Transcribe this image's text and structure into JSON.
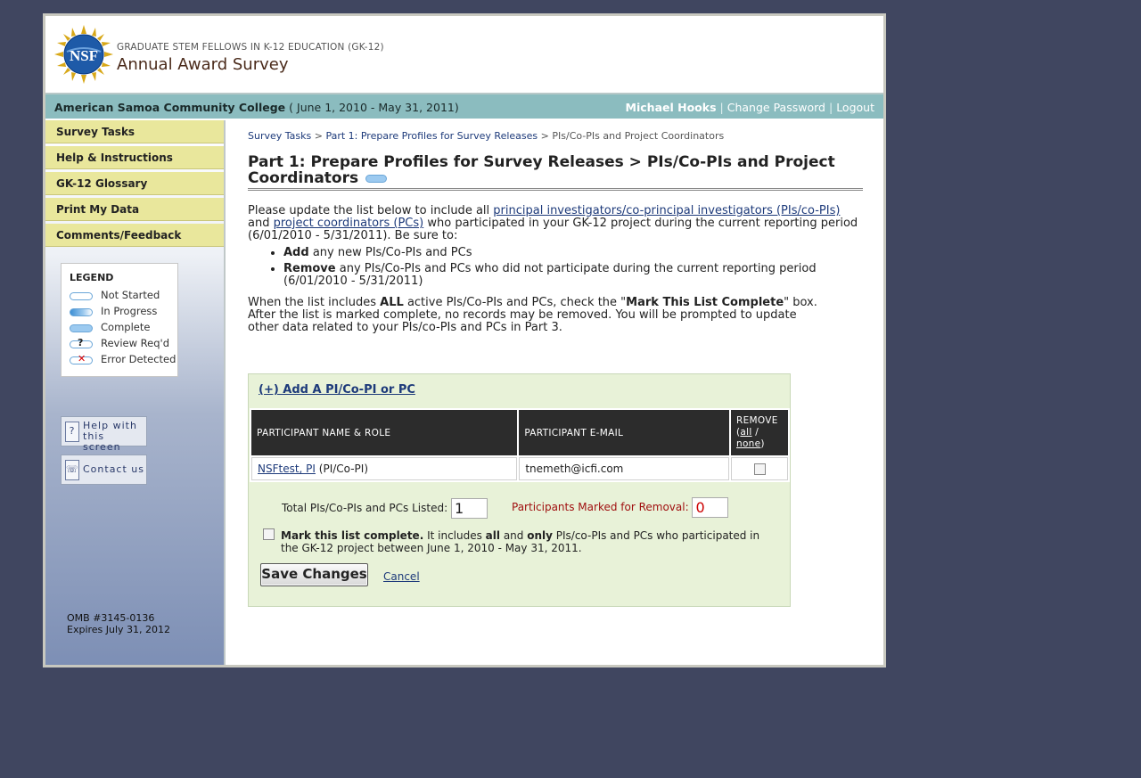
{
  "header": {
    "logo_text": "NSF",
    "program": "GRADUATE STEM FELLOWS IN K-12 EDUCATION (GK-12)",
    "title": "Annual Award Survey"
  },
  "infobar": {
    "institution": "American Samoa Community College",
    "period": "( June 1, 2010 - May 31, 2011)",
    "user_name": "Michael Hooks",
    "change_password": "Change Password",
    "logout": "Logout"
  },
  "sidebar": {
    "items": [
      {
        "label": "Survey Tasks"
      },
      {
        "label": "Help & Instructions"
      },
      {
        "label": "GK-12 Glossary"
      },
      {
        "label": "Print My Data"
      },
      {
        "label": "Comments/Feedback"
      }
    ],
    "legend": {
      "title": "LEGEND",
      "entries": [
        {
          "label": "Not Started",
          "icon": "not-started-icon"
        },
        {
          "label": "In Progress",
          "icon": "in-progress-icon"
        },
        {
          "label": "Complete",
          "icon": "complete-icon"
        },
        {
          "label": "Review Req'd",
          "icon": "review-icon"
        },
        {
          "label": "Error Detected",
          "icon": "error-icon"
        }
      ]
    },
    "help_button": {
      "line1": "Help with",
      "line2": "this screen"
    },
    "contact_button": {
      "label": "Contact us"
    },
    "omb": {
      "line1": "OMB #3145-0136",
      "line2": "Expires July 31, 2012"
    }
  },
  "breadcrumbs": {
    "item1": "Survey Tasks",
    "item2": "Part 1: Prepare Profiles for Survey Releases",
    "current": "PIs/Co-PIs and Project Coordinators",
    "separator": ">"
  },
  "page": {
    "title": "Part 1: Prepare Profiles for Survey Releases > PIs/Co-PIs and Project Coordinators",
    "intro_1": "Please update the list below to include all ",
    "intro_link1": "principal investigators/co-principal investigators (PIs/co-PIs)",
    "intro_2": "and ",
    "intro_link2": "project coordinators (PCs)",
    "intro_3": " who participated in your GK-12 project during the current reporting period (6/01/2010 - 5/31/2011). Be sure to:",
    "bullet1_bold": "Add",
    "bullet1_text": " any new PIs/Co-PIs and PCs",
    "bullet2_bold": "Remove",
    "bullet2_text": " any PIs/Co-PIs and PCs who did not participate during the current reporting period (6/01/2010 - 5/31/2011)",
    "para2_a": "When the list includes ",
    "para2_all": "ALL",
    "para2_b": " active PIs/Co-PIs and PCs, check the \"",
    "para2_mark": "Mark This List Complete",
    "para2_c": "\" box. After the list is marked complete, no records may be removed. You will be prompted to update other data related to your PIs/co-PIs and PCs in Part 3."
  },
  "panel": {
    "add_link": "(+) Add A PI/Co-PI or PC",
    "table": {
      "headers": {
        "name": "PARTICIPANT NAME & ROLE",
        "email": "PARTICIPANT E-MAIL",
        "remove": "REMOVE",
        "all": "all",
        "none": "none"
      },
      "rows": [
        {
          "name": "NSFtest, PI",
          "role": "(PI/Co-PI)",
          "email": "tnemeth@icfi.com",
          "remove": false
        }
      ]
    },
    "total_label": "Total PIs/Co-PIs and PCs Listed:",
    "total_value": "1",
    "removal_label": "Participants Marked for Removal:",
    "removal_value": "0",
    "mark_bold": "Mark this list complete.",
    "mark_text_a": " It includes ",
    "mark_all": "all",
    "mark_text_b": " and ",
    "mark_only": "only",
    "mark_text_c": " PIs/co-PIs and PCs who participated in the GK-12 project between June 1, 2010 - May 31, 2011.",
    "save_label": "Save Changes",
    "cancel_label": "Cancel"
  },
  "colors": {
    "background": "#404660",
    "infobar": "#8bbcbf",
    "nav_item": "#e9e79c",
    "panel": "#e8f2d8",
    "table_header": "#2c2c2c",
    "link": "#1d3a7a",
    "removal": "#a01010"
  }
}
